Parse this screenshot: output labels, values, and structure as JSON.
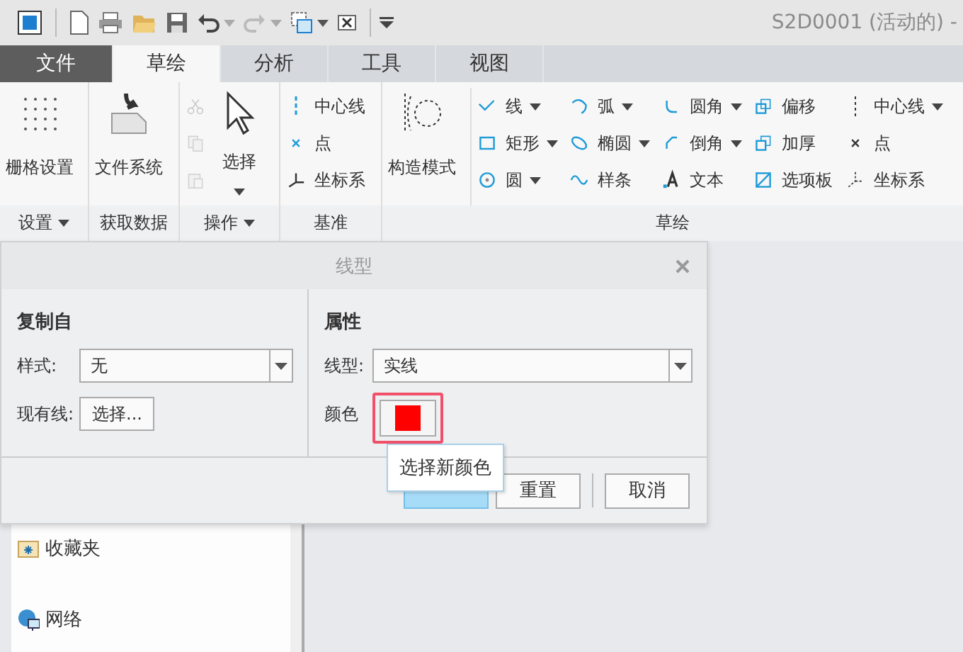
{
  "window": {
    "title": "S2D0001 (活动的) -"
  },
  "tabs": [
    {
      "label": "文件",
      "kind": "file",
      "selected": false
    },
    {
      "label": "草绘",
      "kind": "tab",
      "selected": true
    },
    {
      "label": "分析",
      "kind": "tab",
      "selected": false
    },
    {
      "label": "工具",
      "kind": "tab",
      "selected": false
    },
    {
      "label": "视图",
      "kind": "tab",
      "selected": false
    }
  ],
  "ribbon": {
    "groups": [
      {
        "label": "设置",
        "dropdown": true,
        "columns": [
          [
            {
              "kind": "large",
              "label": "栅格设置",
              "dropdown": false,
              "disabled": false
            }
          ]
        ]
      },
      {
        "label": "获取数据",
        "dropdown": false,
        "columns": [
          [
            {
              "kind": "large",
              "label": "文件系统",
              "dropdown": false,
              "disabled": false
            }
          ]
        ]
      },
      {
        "label": "操作",
        "dropdown": true,
        "columns": [
          [
            {
              "kind": "small",
              "dropdown": false,
              "disabled": true
            },
            {
              "kind": "small",
              "dropdown": false,
              "disabled": true
            },
            {
              "kind": "small",
              "dropdown": false,
              "disabled": true
            }
          ],
          [
            {
              "kind": "large",
              "label": "选择",
              "dropdown": true,
              "disabled": false
            }
          ]
        ]
      },
      {
        "label": "基准",
        "dropdown": false,
        "columns": [
          [
            {
              "kind": "small",
              "label": "中心线",
              "dropdown": false,
              "disabled": false
            },
            {
              "kind": "small",
              "label": "点",
              "dropdown": false,
              "disabled": false
            },
            {
              "kind": "small",
              "label": "坐标系",
              "dropdown": false,
              "disabled": false
            }
          ]
        ]
      },
      {
        "label": "草绘",
        "dropdown": false,
        "columns": [
          [
            {
              "kind": "large",
              "label": "构造模式",
              "dropdown": false,
              "disabled": false
            }
          ],
          [
            {
              "kind": "small",
              "label": "线",
              "dropdown": true,
              "disabled": false
            },
            {
              "kind": "small",
              "label": "矩形",
              "dropdown": true,
              "disabled": false
            },
            {
              "kind": "small",
              "label": "圆",
              "dropdown": true,
              "disabled": false
            }
          ],
          [
            {
              "kind": "small",
              "label": "弧",
              "dropdown": true,
              "disabled": false
            },
            {
              "kind": "small",
              "label": "椭圆",
              "dropdown": true,
              "disabled": false
            },
            {
              "kind": "small",
              "label": "样条",
              "dropdown": false,
              "disabled": false
            }
          ],
          [
            {
              "kind": "small",
              "label": "圆角",
              "dropdown": true,
              "disabled": false
            },
            {
              "kind": "small",
              "label": "倒角",
              "dropdown": true,
              "disabled": false
            },
            {
              "kind": "small",
              "label": "文本",
              "dropdown": false,
              "disabled": false
            }
          ],
          [
            {
              "kind": "small",
              "label": "偏移",
              "dropdown": false,
              "disabled": false
            },
            {
              "kind": "small",
              "label": "加厚",
              "dropdown": false,
              "disabled": false
            },
            {
              "kind": "small",
              "label": "选项板",
              "dropdown": false,
              "disabled": false
            }
          ],
          [
            {
              "kind": "small",
              "label": "中心线",
              "dropdown": true,
              "disabled": false
            },
            {
              "kind": "small",
              "label": "点",
              "dropdown": false,
              "disabled": false
            },
            {
              "kind": "small",
              "label": "坐标系",
              "dropdown": false,
              "disabled": false
            }
          ]
        ]
      }
    ]
  },
  "sidebar": {
    "items": [
      {
        "label": "收藏夹"
      },
      {
        "label": "网络"
      }
    ]
  },
  "dialog": {
    "title": "线型",
    "copy_from": {
      "heading": "复制自",
      "style_label": "样式:",
      "style_value": "无",
      "existing_label": "现有线:",
      "existing_button": "选择..."
    },
    "properties": {
      "heading": "属性",
      "linetype_label": "线型:",
      "linetype_value": "实线",
      "color_label": "颜色",
      "color_swatch": {
        "color": "#ff0000",
        "highlighted": true
      }
    },
    "buttons": [
      {
        "kind": "primary"
      },
      {
        "label": "重置",
        "kind": "normal"
      },
      {
        "label": "取消",
        "kind": "normal"
      }
    ],
    "tooltip": "选择新颜色"
  }
}
